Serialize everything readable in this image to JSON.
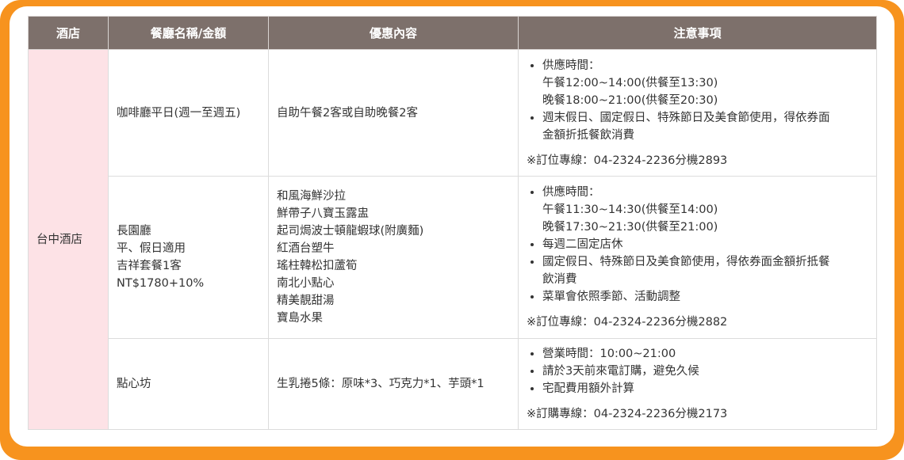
{
  "headers": {
    "hotel": "酒店",
    "restaurant": "餐廳名稱/金額",
    "offer": "優惠內容",
    "notes": "注意事項"
  },
  "hotel_name": "台中酒店",
  "rows": [
    {
      "restaurant_lines": [
        "咖啡廳平日(週一至週五)"
      ],
      "offer_lines": [
        "自助午餐2客或自助晚餐2客"
      ],
      "bullets": [
        [
          "供應時間：",
          "午餐12:00~14:00(供餐至13:30)",
          "晚餐18:00~21:00(供餐至20:30)"
        ],
        [
          "週末假日、國定假日、特殊節日及美食節使用，得依券面",
          "金額折抵餐飲消費"
        ]
      ],
      "note": "※訂位專線：04-2324-2236分機2893"
    },
    {
      "restaurant_lines": [
        "長園廳",
        "平、假日適用",
        "吉祥套餐1客",
        "NT$1780+10%"
      ],
      "offer_lines": [
        "和風海鮮沙拉",
        "鮮帶子八寶玉露盅",
        "起司焗波士頓龍蝦球(附廣麵)",
        "紅酒台塑牛",
        "瑤柱韓松扣蘆筍",
        "南北小點心",
        "精美靚甜湯",
        "寶島水果"
      ],
      "bullets": [
        [
          "供應時間：",
          "午餐11:30~14:30(供餐至14:00)",
          "晚餐17:30~21:30(供餐至21:00)"
        ],
        [
          "每週二固定店休"
        ],
        [
          "國定假日、特殊節日及美食節使用，得依券面金額折抵餐",
          "飲消費"
        ],
        [
          "菜單會依照季節、活動調整"
        ]
      ],
      "note": "※訂位專線：04-2324-2236分機2882"
    },
    {
      "restaurant_lines": [
        "點心坊"
      ],
      "offer_lines": [
        "生乳捲5條：原味*3、巧克力*1、芋頭*1"
      ],
      "bullets": [
        [
          "營業時間：10:00~21:00"
        ],
        [
          "請於3天前來電訂購，避免久候"
        ],
        [
          "宅配費用額外計算"
        ]
      ],
      "note": "※訂購專線：04-2324-2236分機2173"
    }
  ]
}
